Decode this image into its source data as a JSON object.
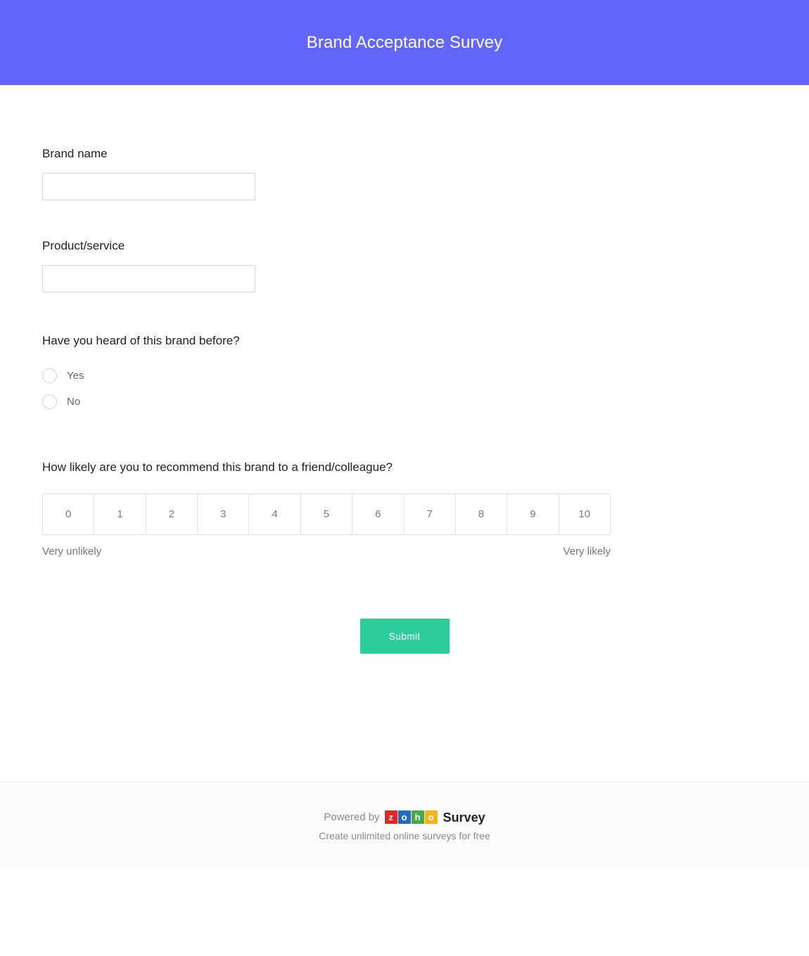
{
  "header": {
    "title": "Brand Acceptance Survey",
    "background_color": "#6366fc",
    "text_color": "#ffffff"
  },
  "questions": {
    "brand_name": {
      "label": "Brand name",
      "value": "",
      "placeholder": ""
    },
    "product_service": {
      "label": "Product/service",
      "value": "",
      "placeholder": ""
    },
    "heard_before": {
      "label": "Have you heard of this brand before?",
      "options": [
        {
          "label": "Yes",
          "selected": false
        },
        {
          "label": "No",
          "selected": false
        }
      ]
    },
    "recommend": {
      "label": "How likely are you to recommend this brand to a friend/colleague?",
      "scale": [
        "0",
        "1",
        "2",
        "3",
        "4",
        "5",
        "6",
        "7",
        "8",
        "9",
        "10"
      ],
      "selected": null,
      "anchor_low": "Very unlikely",
      "anchor_high": "Very likely"
    }
  },
  "actions": {
    "submit_label": "Submit",
    "submit_color": "#2ecc9b"
  },
  "footer": {
    "powered_by": "Powered by",
    "brand_tiles": [
      {
        "letter": "z",
        "color": "#e42527"
      },
      {
        "letter": "o",
        "color": "#226db4"
      },
      {
        "letter": "h",
        "color": "#46a847"
      },
      {
        "letter": "o",
        "color": "#f9b21d"
      }
    ],
    "product_word": "Survey",
    "tagline": "Create unlimited online surveys for free"
  }
}
